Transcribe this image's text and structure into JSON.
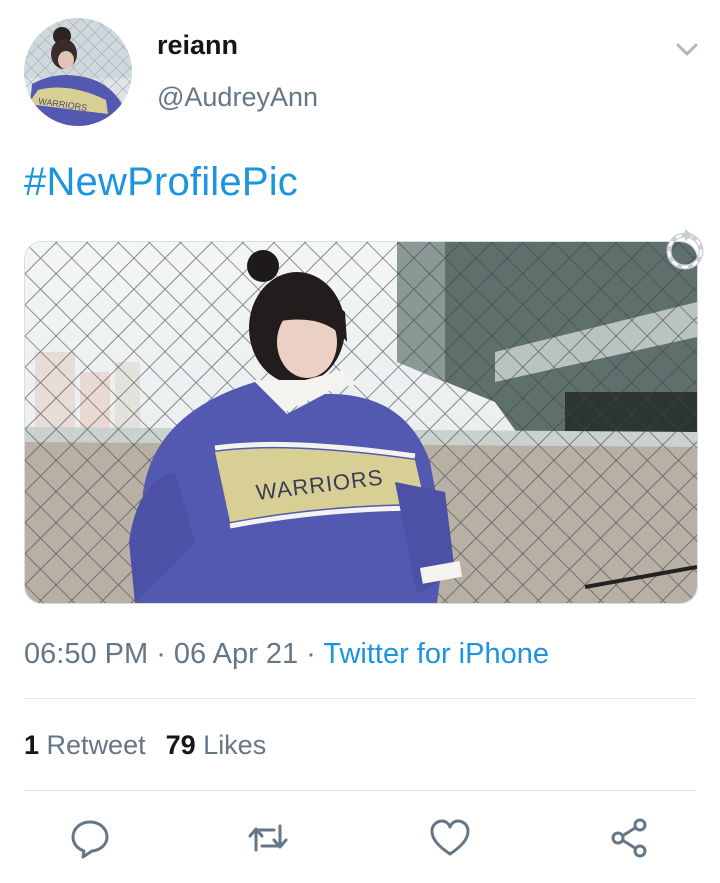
{
  "user": {
    "name": "reiann",
    "handle": "@AudreyAnn"
  },
  "tweet": {
    "text": "#NewProfilePic",
    "media_jersey_text": "WARRIORS",
    "avatar_jersey_text": "WARRIORS"
  },
  "meta": {
    "time": "06:50 PM",
    "dot1": " · ",
    "date": "06 Apr 21",
    "dot2": " · ",
    "source": "Twitter for iPhone"
  },
  "stats": {
    "retweet_count": "1",
    "retweet_label": "Retweet",
    "like_count": "79",
    "like_label": "Likes"
  },
  "icons": {
    "menu": "chevron-down-icon",
    "refresh": "refresh-icon",
    "reply": "reply-icon",
    "retweet": "retweet-icon",
    "like": "heart-icon",
    "share": "share-icon"
  },
  "colors": {
    "link": "#1b95e0",
    "secondary_text": "#657786",
    "jersey_blue": "#5358b0",
    "jersey_yellow": "#d8cf94"
  }
}
